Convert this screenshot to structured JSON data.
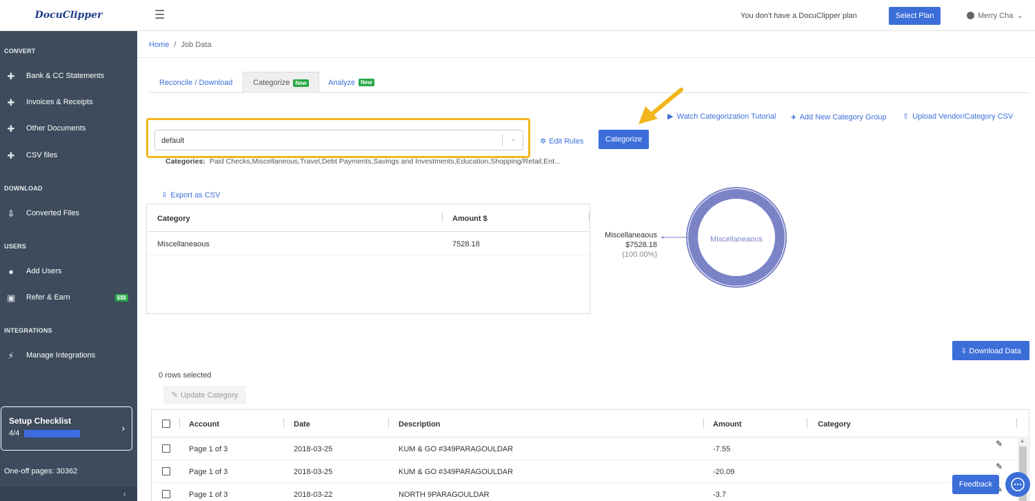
{
  "app": {
    "logo": "DocuClipper"
  },
  "sidebar": {
    "sections": [
      {
        "title": "CONVERT"
      },
      {
        "title": "DOWNLOAD"
      },
      {
        "title": "USERS"
      },
      {
        "title": "INTEGRATIONS"
      }
    ],
    "items": [
      {
        "label": "Bank & CC Statements",
        "icon": "plus-icon"
      },
      {
        "label": "Invoices & Receipts",
        "icon": "plus-icon"
      },
      {
        "label": "Other Documents",
        "icon": "plus-icon"
      },
      {
        "label": "CSV files",
        "icon": "plus-icon"
      },
      {
        "label": "Converted Files",
        "icon": "download-icon"
      },
      {
        "label": "Add Users",
        "icon": "user-icon"
      },
      {
        "label": "Refer & Earn",
        "icon": "gift-icon",
        "badge": "$$$"
      },
      {
        "label": "Manage Integrations",
        "icon": "plug-icon"
      }
    ],
    "checklist": {
      "title": "Setup Checklist",
      "progress_text": "4/4",
      "progress": 1.0
    },
    "oneoff": "One-off pages: 30362"
  },
  "topbar": {
    "plan_note": "You don't have a DocuClipper plan",
    "select_plan": "Select Plan",
    "user": "Merry Cha"
  },
  "breadcrumb": {
    "home": "Home",
    "sep": "/",
    "current": "Job Data"
  },
  "tabs": [
    {
      "label": "Reconcile / Download",
      "badge": ""
    },
    {
      "label": "Categorize",
      "badge": "New"
    },
    {
      "label": "Analyze",
      "badge": "New"
    }
  ],
  "links": {
    "tutorial": "Watch Categorization Tutorial",
    "add_group": "Add New Category Group",
    "upload_csv": "Upload Vendor/Category CSV",
    "edit_rules": "Edit Rules",
    "export_csv": "Export as CSV"
  },
  "group_select": {
    "value": "default"
  },
  "categorize_btn": "Categorize",
  "categories_line": {
    "label": "Categories:",
    "value": "Paid Checks,Miscellaneous,Travel,Debt Payments,Savings and Investments,Education,Shopping/Retail,Ent..."
  },
  "summary_table": {
    "headers": [
      "Category",
      "Amount $"
    ],
    "rows": [
      [
        "Miscellaneaous",
        "7528.18"
      ]
    ]
  },
  "chart_data": {
    "type": "pie",
    "categories": [
      "Miscellaneaous"
    ],
    "values": [
      7528.18
    ],
    "labels": {
      "name": "Miscellaneaous",
      "amount": "$7528.18",
      "percent": "(100.00%)"
    },
    "center_label": "Miscellaneaous",
    "color": "#7b83c7"
  },
  "download_btn": "Download Data",
  "rows_selected": "0 rows selected",
  "update_btn": "Update Category",
  "data_table": {
    "headers": [
      "Account",
      "Date",
      "Description",
      "Amount",
      "Category"
    ],
    "rows": [
      [
        "Page 1 of 3",
        "2018-03-25",
        "KUM & GO #349PARAGOULDAR",
        "-7.55",
        ""
      ],
      [
        "Page 1 of 3",
        "2018-03-25",
        "KUM & GO #349PARAGOULDAR",
        "-20.09",
        ""
      ],
      [
        "Page 1 of 3",
        "2018-03-22",
        "NORTH 9PARAGOULDAR",
        "-3.7",
        ""
      ]
    ]
  },
  "feedback": "Feedback",
  "colors": {
    "primary": "#3b6ed9",
    "sidebar": "#3d4b5c",
    "highlight": "#f2b71c",
    "badge": "#28a745"
  }
}
